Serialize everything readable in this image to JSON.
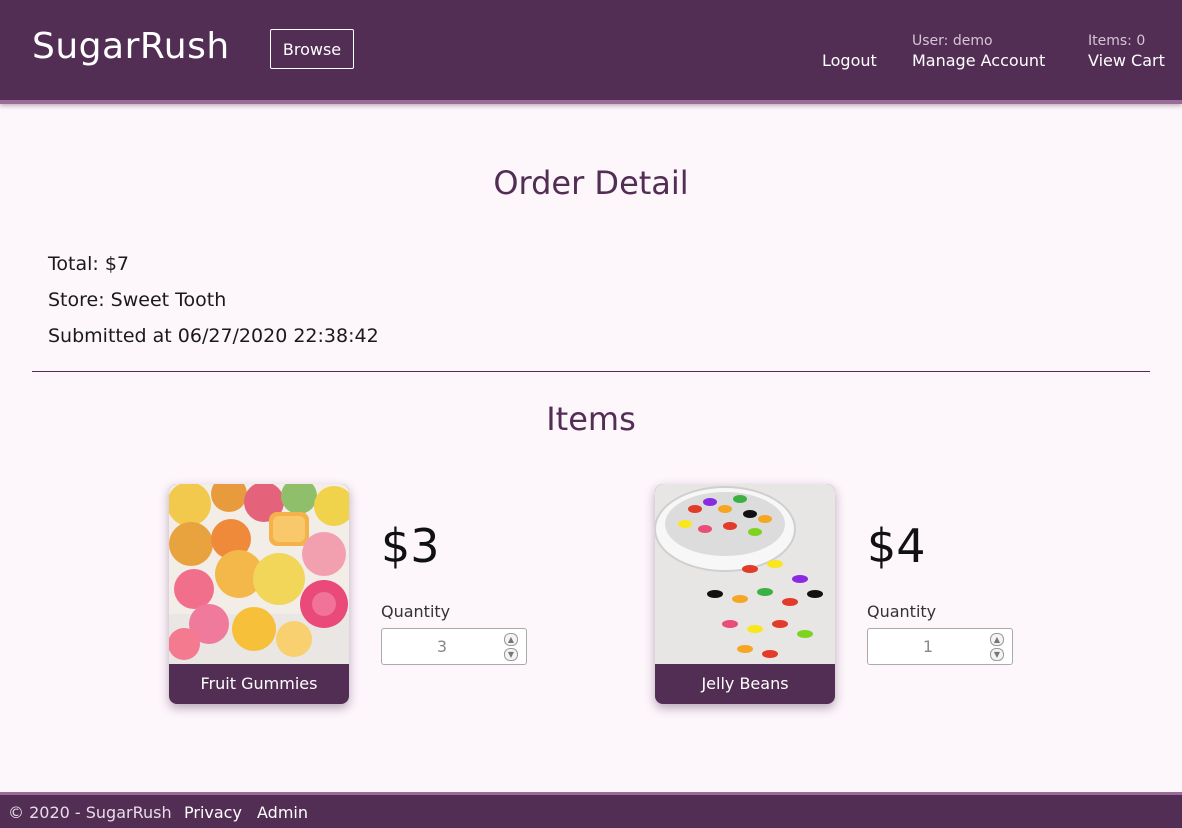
{
  "header": {
    "brand": "SugarRush",
    "browse_label": "Browse",
    "logout_label": "Logout",
    "user_text": "User: demo",
    "manage_account_label": "Manage Account",
    "cart_items_text": "Items: 0",
    "view_cart_label": "View Cart"
  },
  "order": {
    "title": "Order Detail",
    "total": "Total: $7",
    "store": "Store: Sweet Tooth",
    "submitted": "Submitted at 06/27/2020 22:38:42"
  },
  "items_section": {
    "title": "Items",
    "items": [
      {
        "name": "Fruit Gummies",
        "price": "$3",
        "quantity_label": "Quantity",
        "quantity": "3"
      },
      {
        "name": "Jelly Beans",
        "price": "$4",
        "quantity_label": "Quantity",
        "quantity": "1"
      }
    ]
  },
  "footer": {
    "copyright": "© 2020 - SugarRush",
    "privacy_label": "Privacy",
    "admin_label": "Admin"
  },
  "colors": {
    "header_bg": "#522d54",
    "page_bg": "#fdf6fb",
    "accent_border": "#9a6c9a"
  }
}
